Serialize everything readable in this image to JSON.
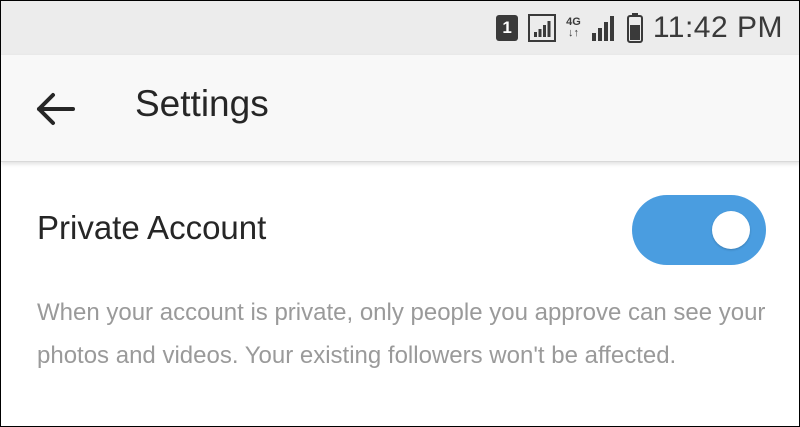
{
  "status_bar": {
    "sim_label": "1",
    "network_label_top": "4G",
    "network_label_bottom": "↓↑",
    "time": "11:42 PM"
  },
  "app_bar": {
    "back_icon": "arrow-left-icon",
    "title": "Settings"
  },
  "private_account": {
    "label": "Private Account",
    "toggle_on": true,
    "toggle_color": "#4a9de0",
    "description": "When your account is private, only people you approve can see your photos and videos. Your existing followers won't be affected."
  }
}
